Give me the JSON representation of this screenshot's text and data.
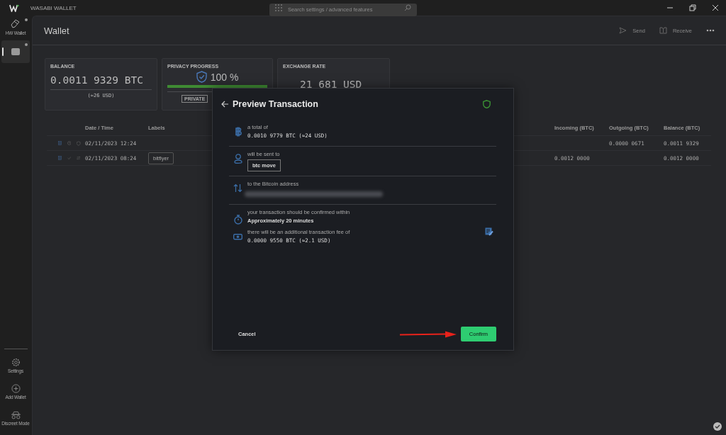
{
  "window": {
    "title": "WASABI WALLET",
    "search": {
      "placeholder": "Search settings / advanced features"
    }
  },
  "sidebar": {
    "items": [
      {
        "label": "HW Wallet",
        "kind": "hw",
        "selected": false
      },
      {
        "kind": "wallet",
        "selected": true
      }
    ],
    "bottom": [
      {
        "label": "Settings",
        "kind": "settings"
      },
      {
        "label": "Add Wallet",
        "kind": "add"
      },
      {
        "label": "Discreet Mode",
        "kind": "discreet"
      }
    ]
  },
  "header": {
    "title": "Wallet",
    "actions": [
      {
        "label": "Send",
        "kind": "send"
      },
      {
        "label": "Receive",
        "kind": "receive"
      }
    ]
  },
  "cards": {
    "balance": {
      "title": "BALANCE",
      "amount": "0.0011 9329 BTC",
      "usd": "(≈26 USD)"
    },
    "privacy": {
      "title": "PRIVACY PROGRESS",
      "percent": "100 %",
      "level": 1,
      "badge": "PRIVATE"
    },
    "rate": {
      "title": "EXCHANGE RATE",
      "amount": "21 681 USD"
    }
  },
  "table": {
    "columns": [
      "Date / Time",
      "Labels",
      "Incoming (BTC)",
      "Outgoing (BTC)",
      "Balance (BTC)"
    ],
    "rows": [
      {
        "kind": "pending",
        "date": "02/11/2023 12:24",
        "labels": [],
        "incoming": "",
        "outgoing": "0.0000 0671",
        "balance": "0.0011 9329"
      },
      {
        "kind": "received",
        "date": "02/11/2023 08:24",
        "labels": [
          "bitflyer"
        ],
        "incoming": "0.0012 0000",
        "outgoing": "",
        "balance": "0.0012 0000"
      }
    ]
  },
  "dialog": {
    "title": "Preview Transaction",
    "sections": [
      {
        "kind": "amount",
        "caption": "a total of",
        "value": "0.0010 9779 BTC (≈24 USD)"
      },
      {
        "kind": "recipient",
        "caption": "will be sent to",
        "tag": "btc move"
      },
      {
        "kind": "address",
        "caption": "to the Bitcoin address"
      },
      {
        "kind": "fee",
        "caption": "your transaction should be confirmed within",
        "value": "Approximately 20 minutes",
        "caption2": "there will be an additional transaction fee of",
        "value2": "0.0000 9550 BTC (≈2.1 USD)"
      }
    ],
    "cancel": "Cancel",
    "confirm": "Confirm"
  }
}
